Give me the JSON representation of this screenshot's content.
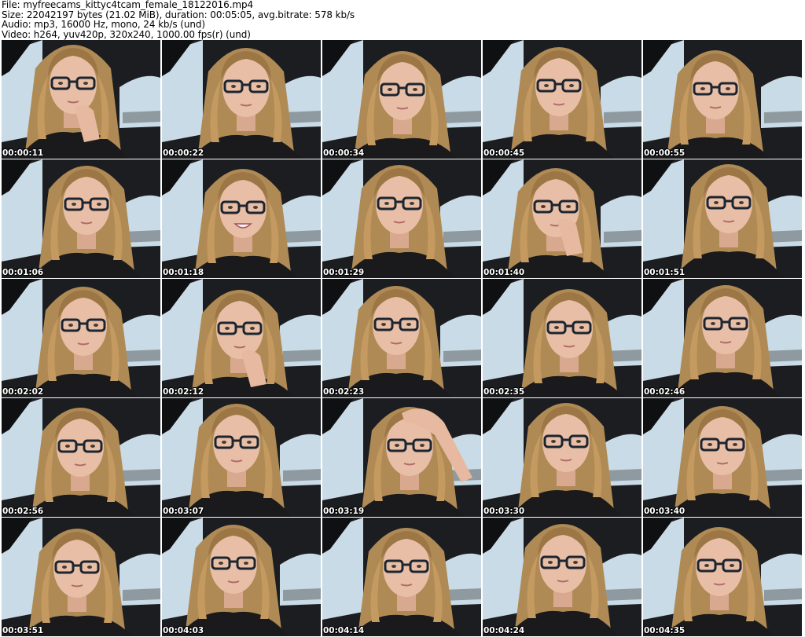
{
  "header": {
    "file_line": "File: myfreecams_kittyc4tcam_female_18122016.mp4",
    "size_line": "Size: 22042197 bytes (21.02 MiB), duration: 00:05:05, avg.bitrate: 578 kb/s",
    "audio_line": "Audio: mp3, 16000 Hz, mono, 24 kb/s (und)",
    "video_line": "Video: h264, yuv420p, 320x240, 1000.00 fps(r) (und)"
  },
  "thumbnails": [
    {
      "timestamp": "00:00:11",
      "pose": "hand-chin"
    },
    {
      "timestamp": "00:00:22",
      "pose": "neutral"
    },
    {
      "timestamp": "00:00:34",
      "pose": "neutral"
    },
    {
      "timestamp": "00:00:45",
      "pose": "neutral"
    },
    {
      "timestamp": "00:00:55",
      "pose": "neutral"
    },
    {
      "timestamp": "00:01:06",
      "pose": "neutral"
    },
    {
      "timestamp": "00:01:18",
      "pose": "smile"
    },
    {
      "timestamp": "00:01:29",
      "pose": "neutral"
    },
    {
      "timestamp": "00:01:40",
      "pose": "hand-mouth"
    },
    {
      "timestamp": "00:01:51",
      "pose": "neutral"
    },
    {
      "timestamp": "00:02:02",
      "pose": "neutral"
    },
    {
      "timestamp": "00:02:12",
      "pose": "hand-chin"
    },
    {
      "timestamp": "00:02:23",
      "pose": "neutral"
    },
    {
      "timestamp": "00:02:35",
      "pose": "neutral"
    },
    {
      "timestamp": "00:02:46",
      "pose": "neutral"
    },
    {
      "timestamp": "00:02:56",
      "pose": "neutral"
    },
    {
      "timestamp": "00:03:07",
      "pose": "neutral"
    },
    {
      "timestamp": "00:03:19",
      "pose": "hand-head"
    },
    {
      "timestamp": "00:03:30",
      "pose": "neutral"
    },
    {
      "timestamp": "00:03:40",
      "pose": "neutral"
    },
    {
      "timestamp": "00:03:51",
      "pose": "neutral"
    },
    {
      "timestamp": "00:04:03",
      "pose": "neutral"
    },
    {
      "timestamp": "00:04:14",
      "pose": "neutral"
    },
    {
      "timestamp": "00:04:24",
      "pose": "neutral"
    },
    {
      "timestamp": "00:04:35",
      "pose": "neutral"
    }
  ],
  "colors": {
    "sky": "#c9dbe6",
    "car_interior": "#1b1d20",
    "hair": "#b08a55",
    "skin": "#e8bfa6",
    "glasses": "#1c2530",
    "shirt": "#1a1a1c",
    "timestamp_text": "#ffffff"
  }
}
